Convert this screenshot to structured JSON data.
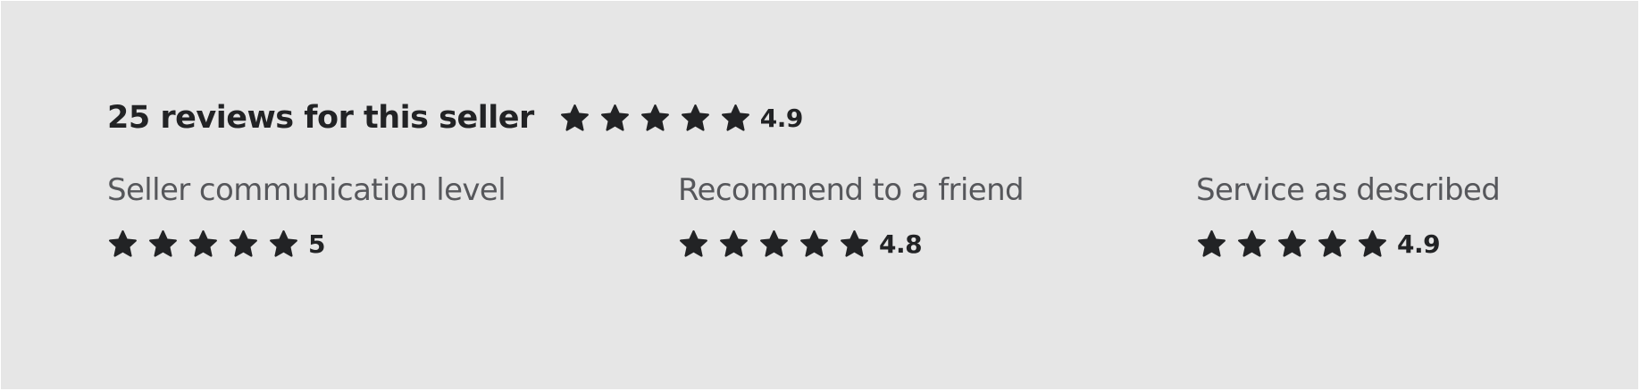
{
  "summary": {
    "title": "25 reviews for this seller",
    "rating": "4.9",
    "star_count": 5,
    "star_icon": "star-icon"
  },
  "categories": [
    {
      "label": "Seller communication level",
      "rating": "5"
    },
    {
      "label": "Recommend to a friend",
      "rating": "4.8"
    },
    {
      "label": "Service as described",
      "rating": "4.9"
    }
  ],
  "colors": {
    "background": "#e6e6e6",
    "star": "#222325",
    "heading": "#222325",
    "label": "#56575b"
  }
}
